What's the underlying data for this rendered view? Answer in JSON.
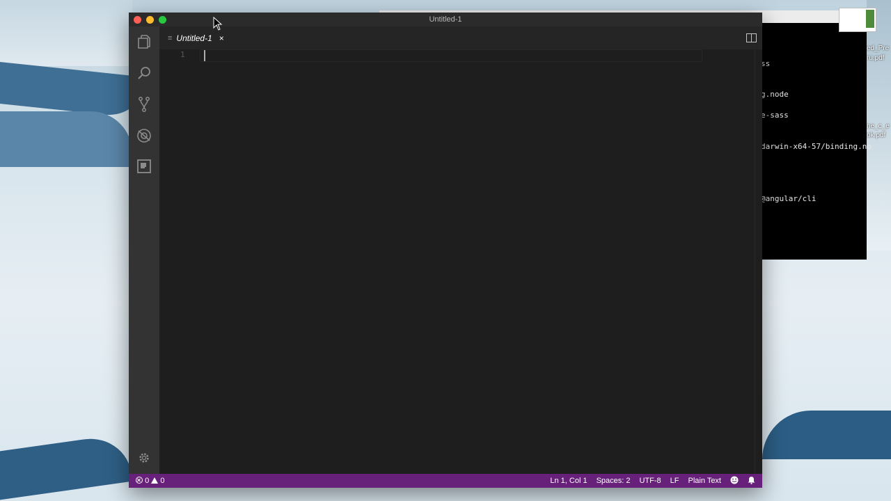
{
  "window": {
    "title": "Untitled-1"
  },
  "activity_bar": {
    "items": [
      "explorer-icon",
      "search-icon",
      "source-control-icon",
      "debug-icon",
      "extensions-icon"
    ],
    "settings": "gear-icon"
  },
  "tab": {
    "label": "Untitled-1",
    "close": "×"
  },
  "editor": {
    "line_number": "1"
  },
  "status_bar": {
    "errors": "0",
    "warnings": "0",
    "position": "Ln 1, Col 1",
    "indent": "Spaces: 2",
    "encoding": "UTF-8",
    "eol": "LF",
    "language": "Plain Text",
    "color": "#68217a"
  },
  "terminal_bg": {
    "lines": [
      "ss",
      "g.node",
      "e-sass",
      "darwin-x64-57/binding.no",
      "@angular/cli"
    ]
  },
  "desktop_files": [
    "ed_Pre",
    "ru.pdf",
    "ne_c_e",
    "ok.pdf"
  ]
}
